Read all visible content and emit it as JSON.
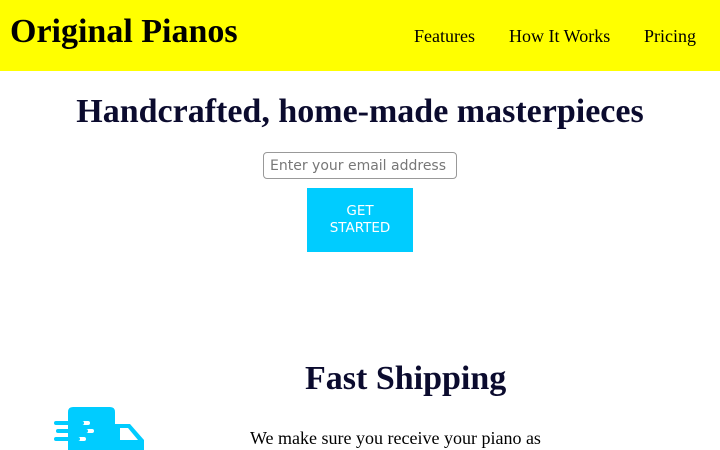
{
  "header": {
    "logo": "Original Pianos",
    "nav": {
      "features": "Features",
      "how_it_works": "How It Works",
      "pricing": "Pricing"
    },
    "background_color": "#ffff00"
  },
  "hero": {
    "title": "Handcrafted, home-made masterpieces",
    "email_placeholder": "Enter your email address",
    "cta_label": "GET STARTED",
    "cta_color": "#00ccff"
  },
  "features": {
    "items": [
      {
        "title": "Fast Shipping",
        "icon": "truck-icon",
        "description": "We make sure you receive your piano as"
      }
    ]
  }
}
